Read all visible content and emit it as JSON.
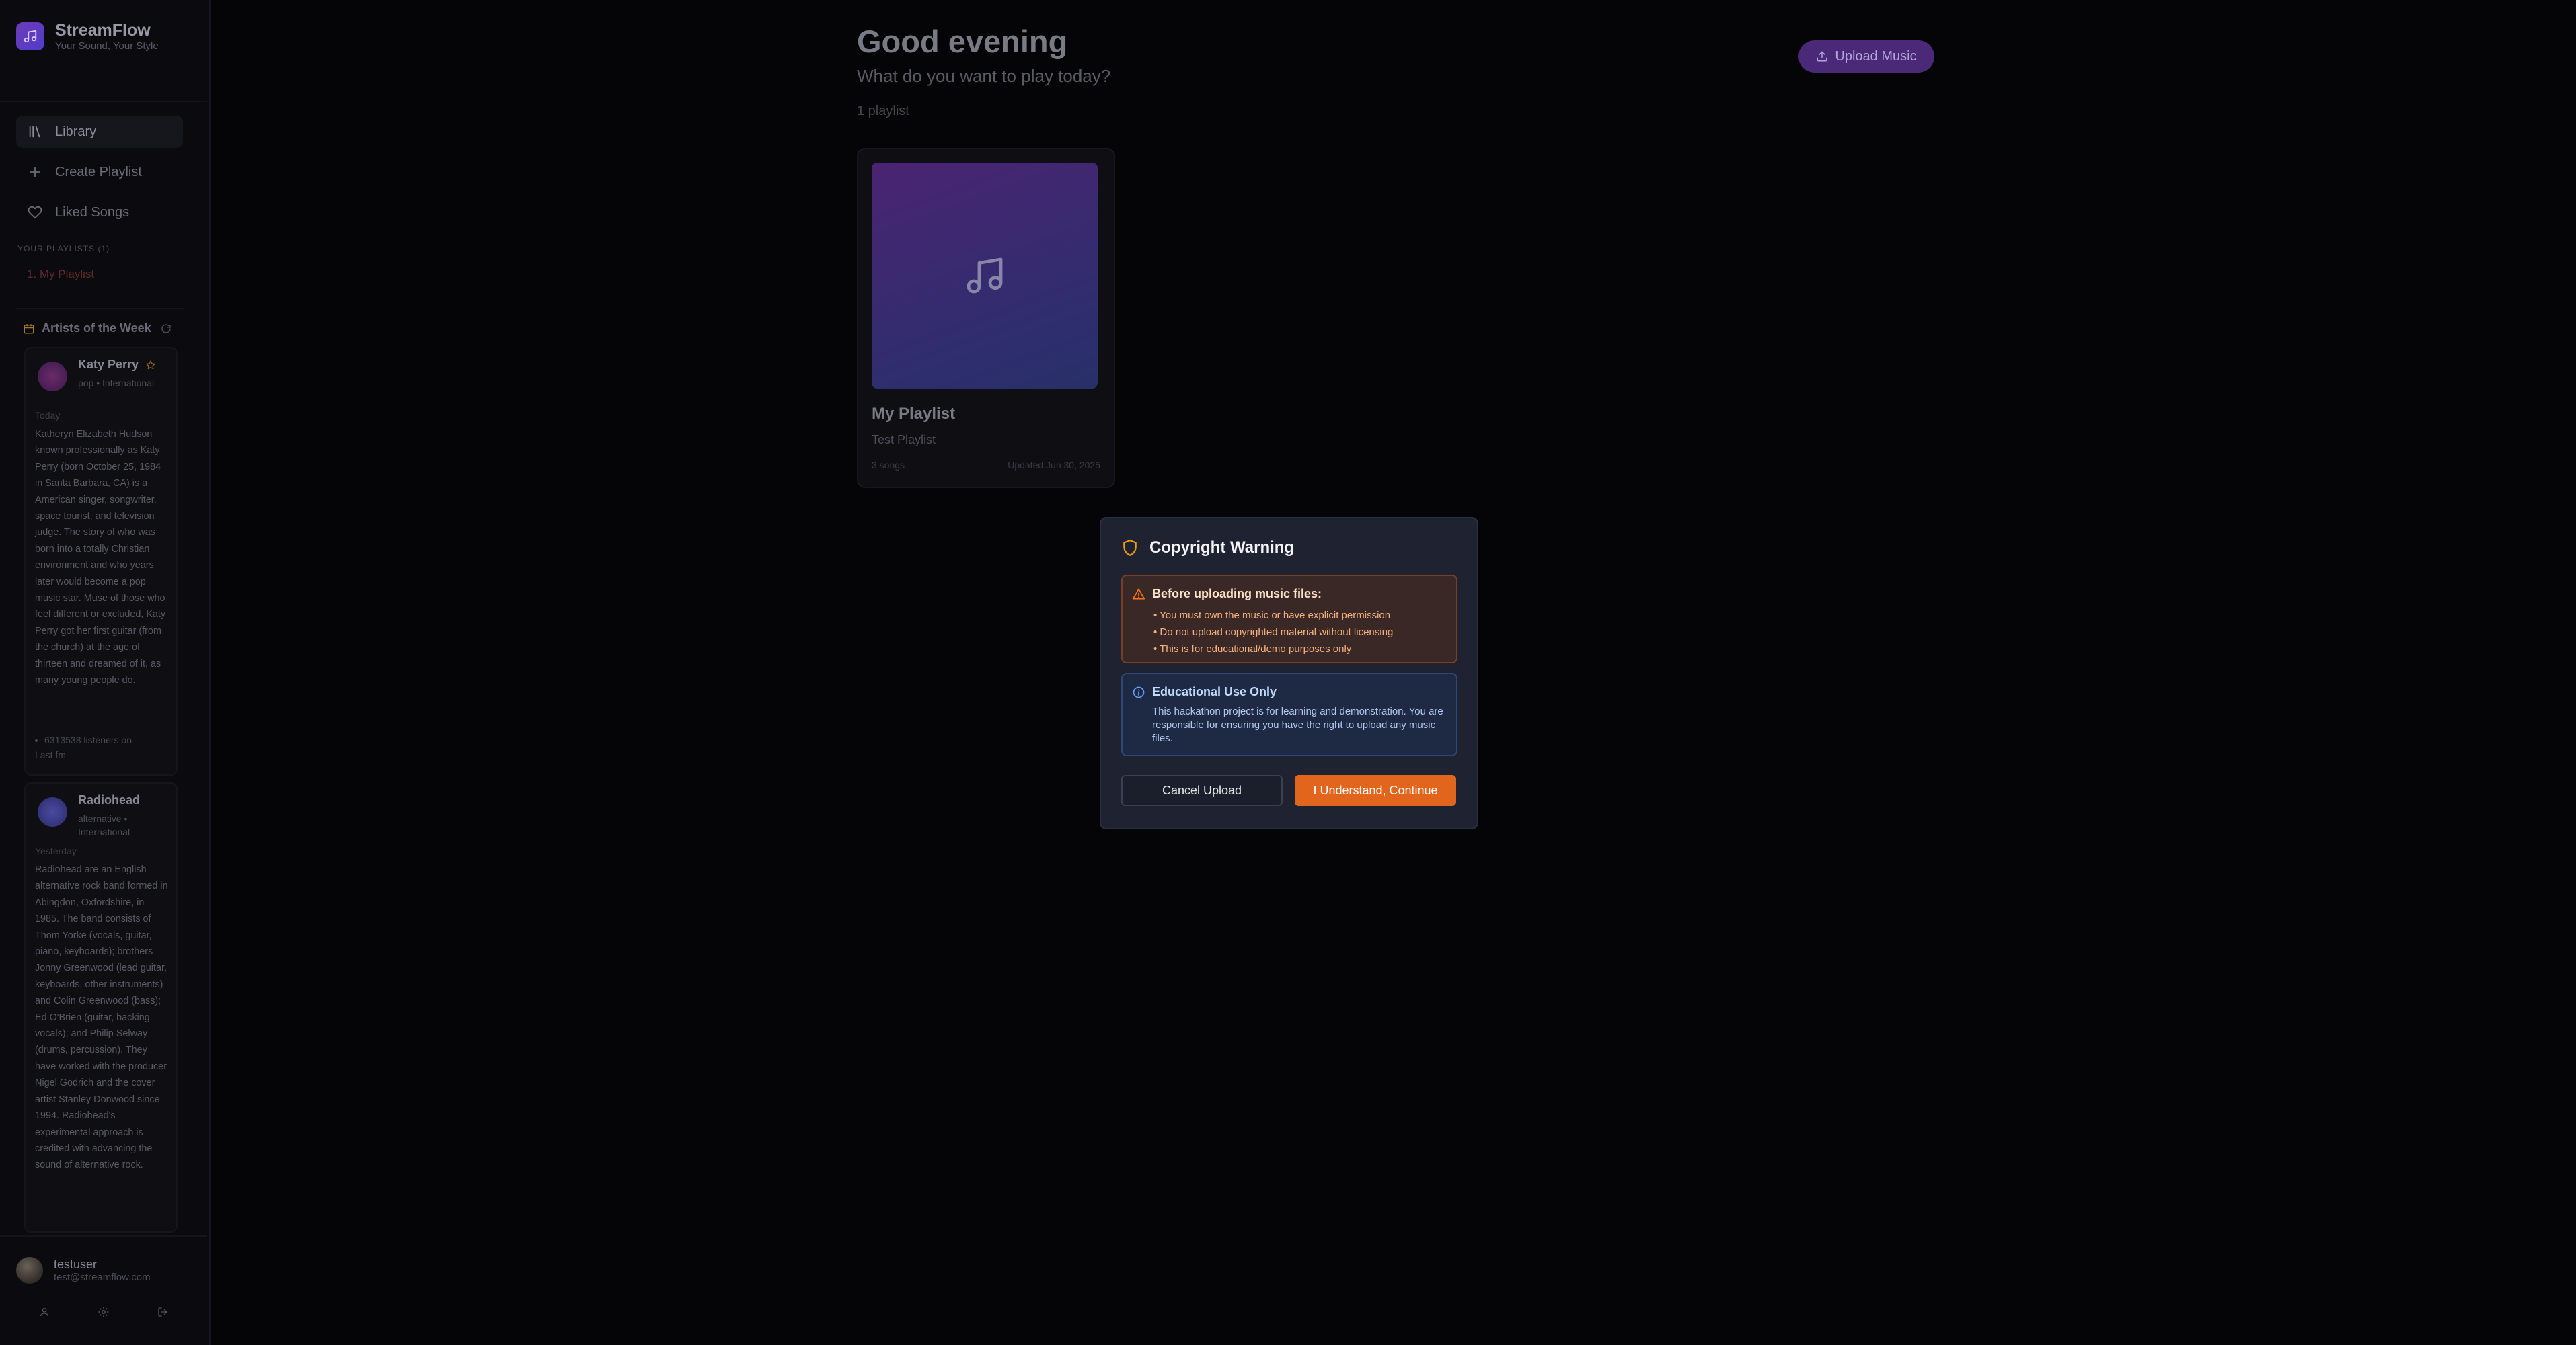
{
  "brand": {
    "name": "StreamFlow",
    "tagline": "Your Sound, Your Style"
  },
  "nav": [
    {
      "label": "Library",
      "icon": "library-icon",
      "active": true
    },
    {
      "label": "Create Playlist",
      "icon": "plus-icon",
      "active": false
    },
    {
      "label": "Liked Songs",
      "icon": "heart-icon",
      "active": false
    }
  ],
  "playlists": {
    "heading": "YOUR PLAYLISTS (1)",
    "items": [
      "1. My Playlist"
    ]
  },
  "artists_week": {
    "title": "Artists of the Week",
    "artists": [
      {
        "name": "Katy Perry",
        "genre": "pop • International",
        "day": "Today",
        "bio": "Katheryn Elizabeth Hudson known professionally as Katy Perry (born October 25, 1984 in Santa Barbara, CA) is a American singer, songwriter, space tourist, and television judge. The story of who was born into a totally Christian environment and who years later would become a pop music star. Muse of those who feel different or excluded, Katy Perry got her first guitar (from the church) at the age of thirteen and dreamed of it, as many young people do.",
        "listeners": "6313538 listeners on Last.fm"
      },
      {
        "name": "Radiohead",
        "genre": "alternative • International",
        "day": "Yesterday",
        "bio": "Radiohead are an English alternative rock band formed in Abingdon, Oxfordshire, in 1985. The band consists of Thom Yorke (vocals, guitar, piano, keyboards); brothers Jonny Greenwood (lead guitar, keyboards, other instruments) and Colin Greenwood (bass); Ed O'Brien (guitar, backing vocals); and Philip Selway (drums, percussion). They have worked with the producer Nigel Godrich and the cover artist Stanley Donwood since 1994. Radiohead's experimental approach is credited with advancing the sound of alternative rock."
      }
    ]
  },
  "user": {
    "name": "testuser",
    "email": "test@streamflow.com"
  },
  "main": {
    "greeting": "Good evening",
    "subtitle": "What do you want to play today?",
    "playlist_count": "1 playlist",
    "upload_label": "Upload Music",
    "playlist_card": {
      "title": "My Playlist",
      "description": "Test Playlist",
      "songs": "3 songs",
      "updated": "Updated Jun 30, 2025"
    }
  },
  "modal": {
    "title": "Copyright Warning",
    "warning_heading": "Before uploading music files:",
    "warning_items": [
      "• You must own the music or have explicit permission",
      "• Do not upload copyrighted material without licensing",
      "• This is for educational/demo purposes only"
    ],
    "info_heading": "Educational Use Only",
    "info_text": "This hackathon project is for learning and demonstration. You are responsible for ensuring you have the right to upload any music files.",
    "cancel_label": "Cancel Upload",
    "confirm_label": "I Understand, Continue"
  },
  "colors": {
    "accent": "#e2651d",
    "brand": "#6d3bb8",
    "modal_bg": "#1f2331"
  }
}
